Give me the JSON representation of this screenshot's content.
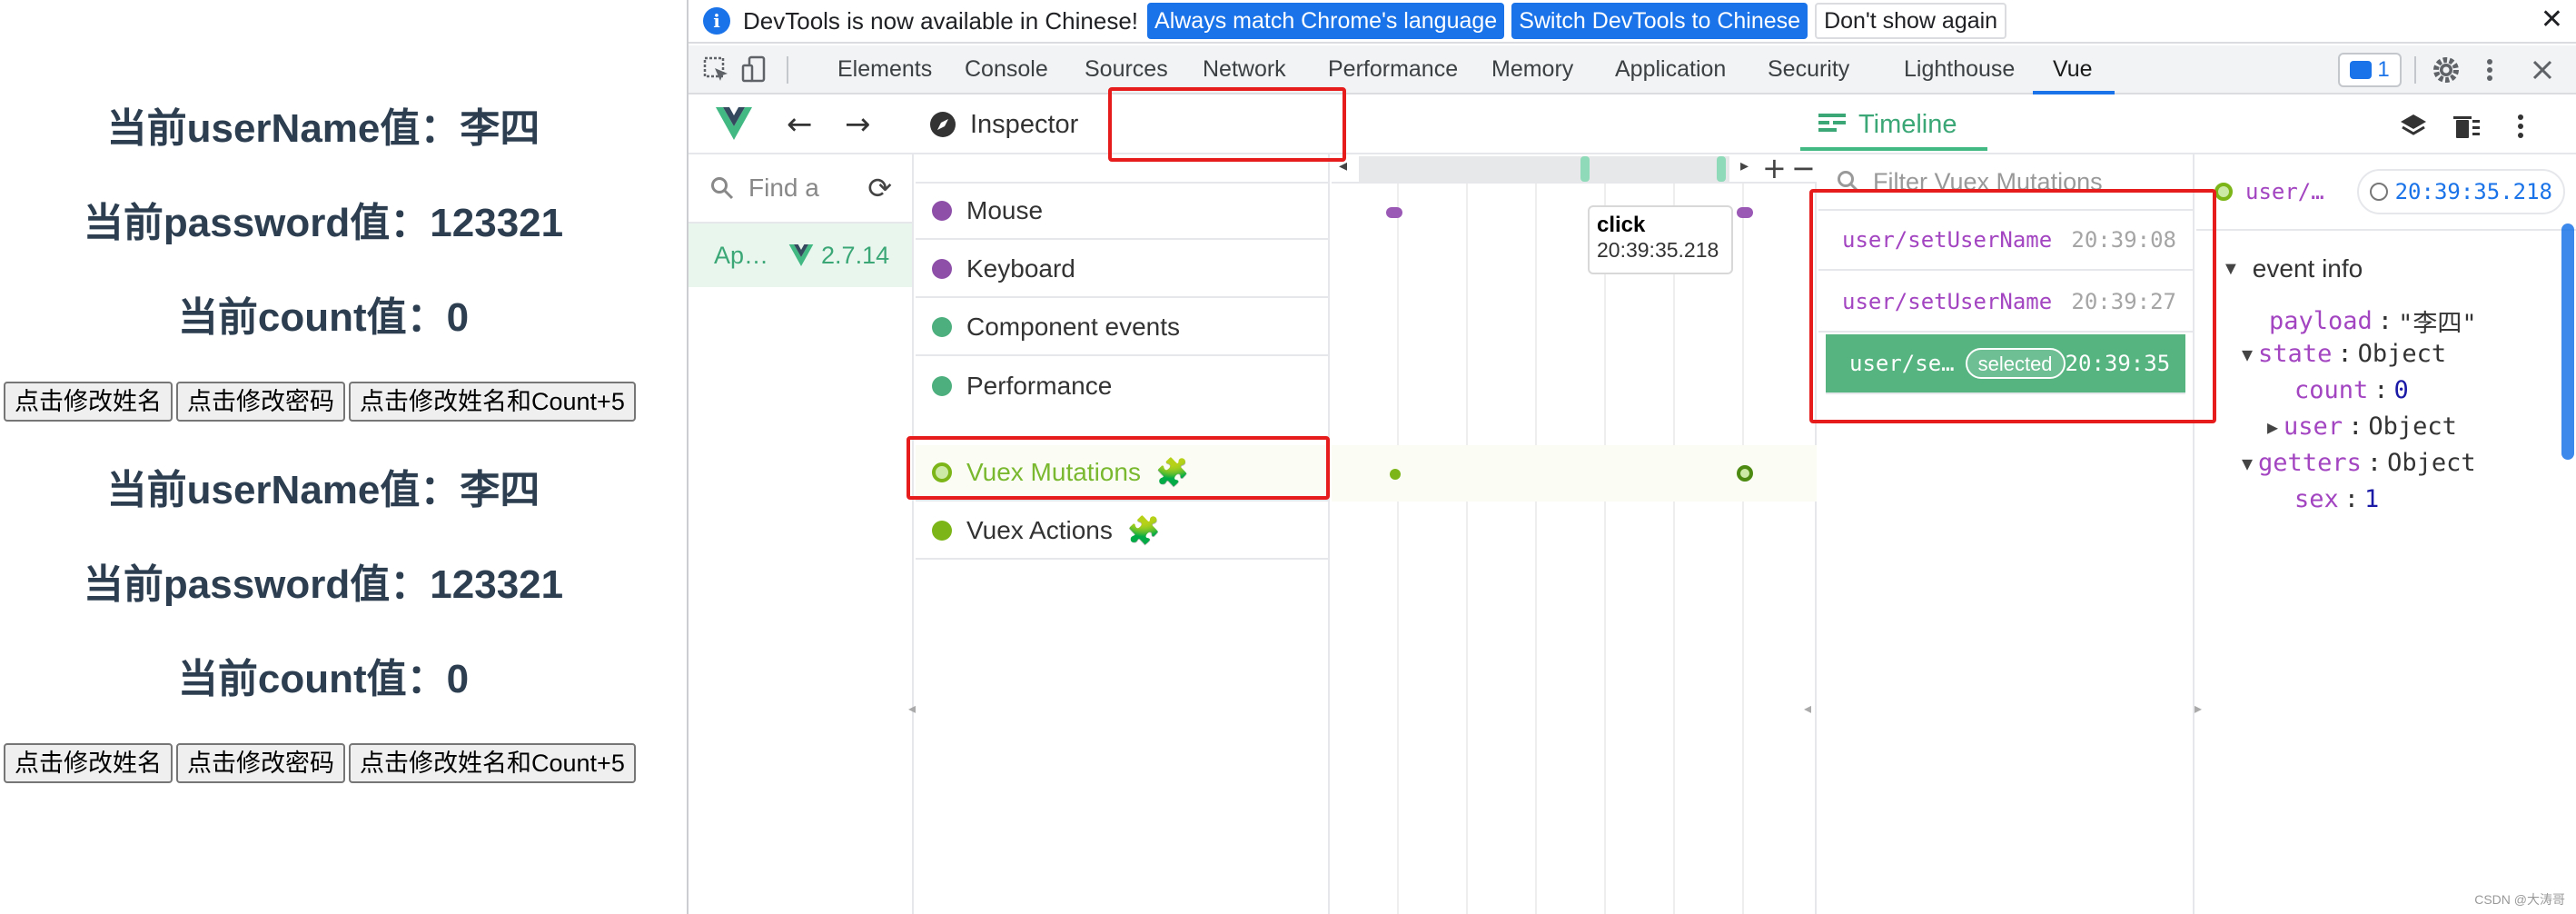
{
  "app": {
    "sections": [
      {
        "username_line": "当前userName值：李四",
        "password_line": "当前password值：123321",
        "count_line": "当前count值：0",
        "buttons": [
          "点击修改姓名",
          "点击修改密码",
          "点击修改姓名和Count+5"
        ]
      },
      {
        "username_line": "当前userName值：李四",
        "password_line": "当前password值：123321",
        "count_line": "当前count值：0",
        "buttons": [
          "点击修改姓名",
          "点击修改密码",
          "点击修改姓名和Count+5"
        ]
      }
    ]
  },
  "infobar": {
    "message": "DevTools is now available in Chinese!",
    "btn_match": "Always match Chrome's language",
    "btn_switch": "Switch DevTools to Chinese",
    "btn_dismiss": "Don't show again",
    "close": "✕"
  },
  "tabs": [
    "Elements",
    "Console",
    "Sources",
    "Network",
    "Performance",
    "Memory",
    "Application",
    "Security",
    "Lighthouse",
    "Vue"
  ],
  "active_tab": "Vue",
  "issues_count": "1",
  "vue": {
    "tab_inspector": "Inspector",
    "tab_timeline": "Timeline",
    "app_search_placeholder": "Find a",
    "app_item_name": "Ap…",
    "app_item_version": "2.7.14",
    "layers": [
      {
        "label": "Mouse",
        "color": "#8e4fa9"
      },
      {
        "label": "Keyboard",
        "color": "#8e4fa9"
      },
      {
        "label": "Component events",
        "color": "#4caf7d"
      },
      {
        "label": "Performance",
        "color": "#4caf7d"
      },
      {
        "label": "Vuex Mutations",
        "color": "#7cb518"
      },
      {
        "label": "Vuex Actions",
        "color": "#7cb518"
      }
    ],
    "tooltip": {
      "title": "click",
      "time": "20:39:35.218"
    },
    "events_filter_placeholder": "Filter Vuex Mutations",
    "events": [
      {
        "name": "user/setUserName",
        "time": "20:39:08"
      },
      {
        "name": "user/setUserName",
        "time": "20:39:27"
      },
      {
        "name": "user/se…",
        "badge": "selected",
        "time": "20:39:35"
      }
    ],
    "details": {
      "name": "user/…",
      "time": "20:39:35.218",
      "section": "event info",
      "payload_key": "payload",
      "payload_value": "\"李四\"",
      "state_key": "state",
      "state_value": "Object",
      "count_key": "count",
      "count_value": "0",
      "user_key": "user",
      "user_value": "Object",
      "getters_key": "getters",
      "getters_value": "Object",
      "sex_key": "sex",
      "sex_value": "1"
    }
  },
  "colors": {
    "vue_green": "#42b883",
    "chrome_blue": "#1a73e8",
    "annotation_red": "#e61c1c"
  },
  "watermark": "CSDN @大涛哥"
}
